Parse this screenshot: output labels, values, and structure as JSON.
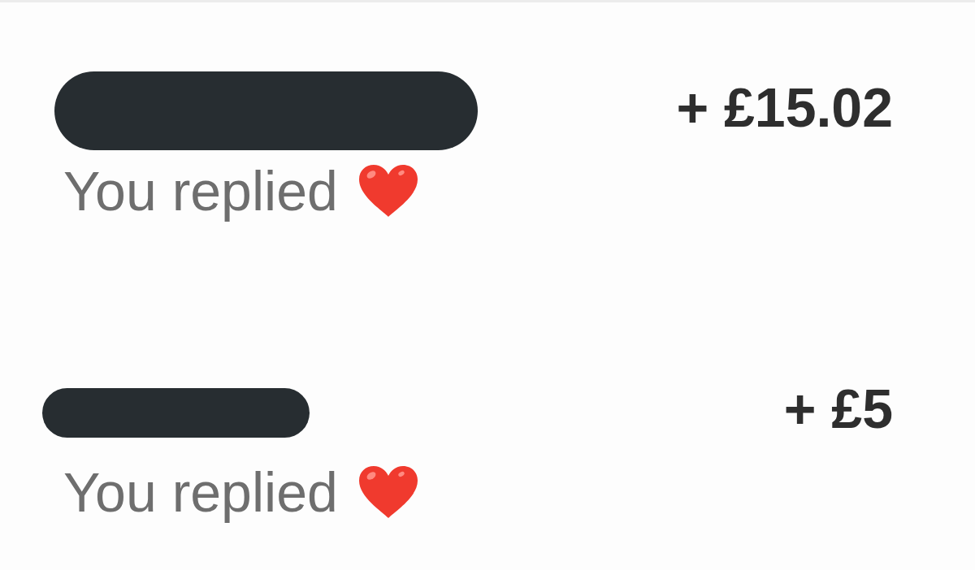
{
  "transactions": [
    {
      "name_redacted": true,
      "amount": "+ £15.02",
      "message": "You replied"
    },
    {
      "name_redacted": true,
      "amount": "+ £5",
      "message": "You replied"
    }
  ]
}
